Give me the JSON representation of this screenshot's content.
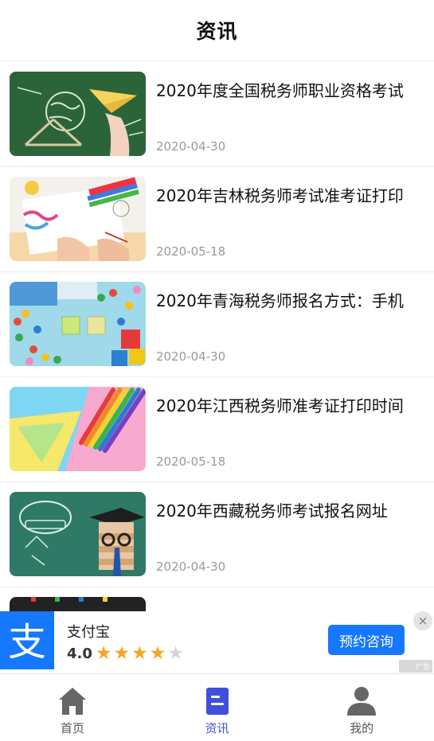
{
  "header": {
    "title": "资讯"
  },
  "news": [
    {
      "title": "2020年度全国税务师职业资格考试",
      "date": "2020-04-30",
      "thumb": "chalkboard-globe-paper-plane"
    },
    {
      "title": "2020年吉林税务师考试准考证打印",
      "date": "2020-05-18",
      "thumb": "child-drawing-crayons"
    },
    {
      "title": "2020年青海税务师报名方式：手机",
      "date": "2020-04-30",
      "thumb": "colorful-candies-letter-blocks"
    },
    {
      "title": "2020年江西税务师准考证打印时间",
      "date": "2020-05-18",
      "thumb": "colored-pencils-paper"
    },
    {
      "title": "2020年西藏税务师考试报名网址",
      "date": "2020-04-30",
      "thumb": "education-chalkboard-graduate-books"
    }
  ],
  "ad": {
    "logo_icon": "alipay-logo-icon",
    "logo_glyph": "支",
    "name": "支付宝",
    "rating": "4.0",
    "stars_filled": 4,
    "stars_total": 5,
    "button": "预约咨询",
    "close": "×",
    "tag": "广告"
  },
  "tabs": [
    {
      "label": "首页",
      "icon": "home-icon",
      "active": false
    },
    {
      "label": "资讯",
      "icon": "news-document-icon",
      "active": true
    },
    {
      "label": "我的",
      "icon": "user-profile-icon",
      "active": false
    }
  ],
  "colors": {
    "accent": "#3f51d8",
    "ad_blue": "#1677ff",
    "star": "#f5a623"
  }
}
